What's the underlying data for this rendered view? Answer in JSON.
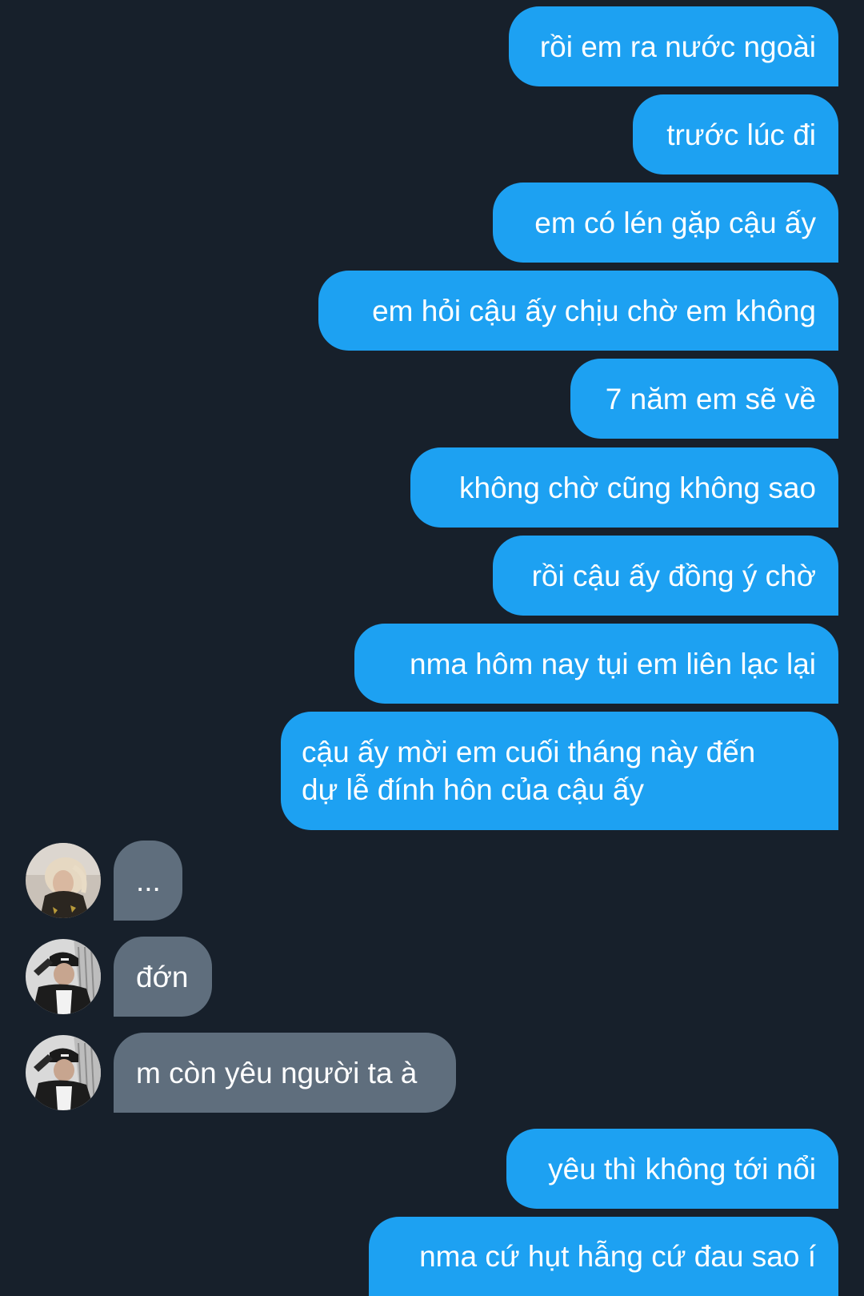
{
  "colors": {
    "background": "#17202b",
    "sent_bubble": "#1da1f2",
    "received_bubble": "#5f6e7d",
    "text": "#ffffff"
  },
  "messages": [
    {
      "direction": "sent",
      "text": "rồi em ra nước ngoài"
    },
    {
      "direction": "sent",
      "text": "trước lúc đi"
    },
    {
      "direction": "sent",
      "text": "em có lén gặp cậu ấy"
    },
    {
      "direction": "sent",
      "text": "em hỏi cậu ấy chịu chờ em không"
    },
    {
      "direction": "sent",
      "text": "7 năm em sẽ về"
    },
    {
      "direction": "sent",
      "text": "không chờ cũng không sao"
    },
    {
      "direction": "sent",
      "text": "rồi cậu ấy đồng ý chờ"
    },
    {
      "direction": "sent",
      "text": "nma hôm nay tụi em liên lạc lại"
    },
    {
      "direction": "sent",
      "text": "cậu ấy mời em cuối tháng này đến\ndự lễ đính hôn của cậu ấy"
    },
    {
      "direction": "received",
      "avatar": "avatar-blonde-person",
      "text": "..."
    },
    {
      "direction": "received",
      "avatar": "avatar-person-black-cap",
      "text": "đớn"
    },
    {
      "direction": "received",
      "avatar": "avatar-person-black-cap",
      "text": "m còn yêu người ta à"
    },
    {
      "direction": "sent",
      "text": "yêu thì không tới nổi"
    },
    {
      "direction": "sent",
      "text": "nma cứ hụt hẫng cứ đau sao í"
    }
  ]
}
